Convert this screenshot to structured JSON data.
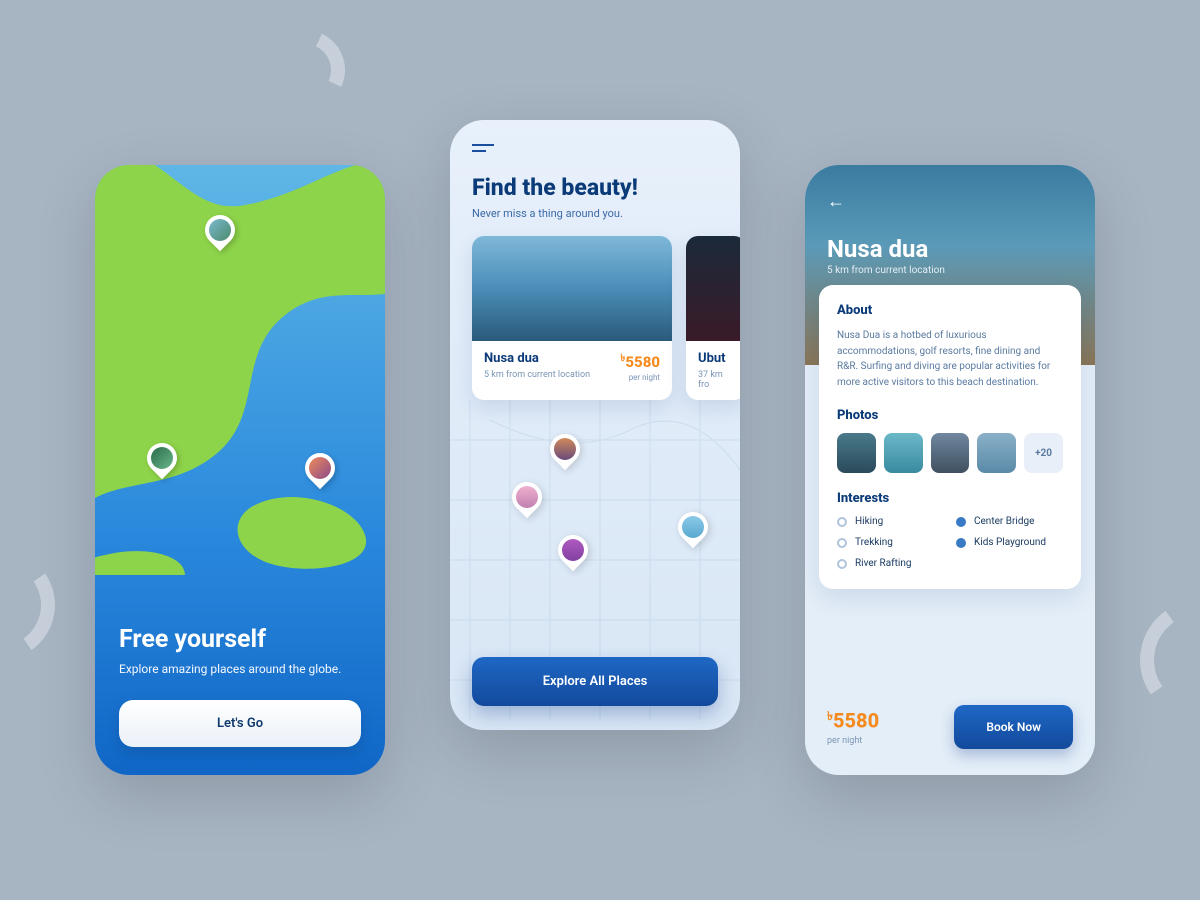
{
  "colors": {
    "primary_blue": "#124a9c",
    "accent_orange": "#f58a1f",
    "page_bg": "#a7b4c2"
  },
  "screen1": {
    "title": "Free yourself",
    "subtitle": "Explore amazing places around the globe.",
    "cta": "Let's Go"
  },
  "screen2": {
    "title": "Find the beauty!",
    "subtitle": "Never miss a thing around you.",
    "cards": [
      {
        "name": "Nusa dua",
        "distance": "5 km from current location",
        "currency": "৳",
        "price": "5580",
        "per": "per night"
      },
      {
        "name": "Ubut",
        "distance": "37 km fro",
        "currency": "",
        "price": "",
        "per": ""
      }
    ],
    "cta": "Explore All Places"
  },
  "screen3": {
    "title": "Nusa dua",
    "subtitle": "5 km from current location",
    "about": {
      "heading": "About",
      "text": "Nusa Dua is a hotbed of luxurious accommodations, golf resorts, fine dining and R&R. Surfing and diving are popular activities for more active visitors to this beach destination."
    },
    "photos": {
      "heading": "Photos",
      "more": "+20"
    },
    "interests": {
      "heading": "Interests",
      "items": [
        "Hiking",
        "Trekking",
        "River Rafting",
        "Center Bridge",
        "Kids Playground"
      ],
      "checked": [
        3,
        4
      ]
    },
    "currency": "৳",
    "price": "5580",
    "per": "per night",
    "cta": "Book Now"
  }
}
